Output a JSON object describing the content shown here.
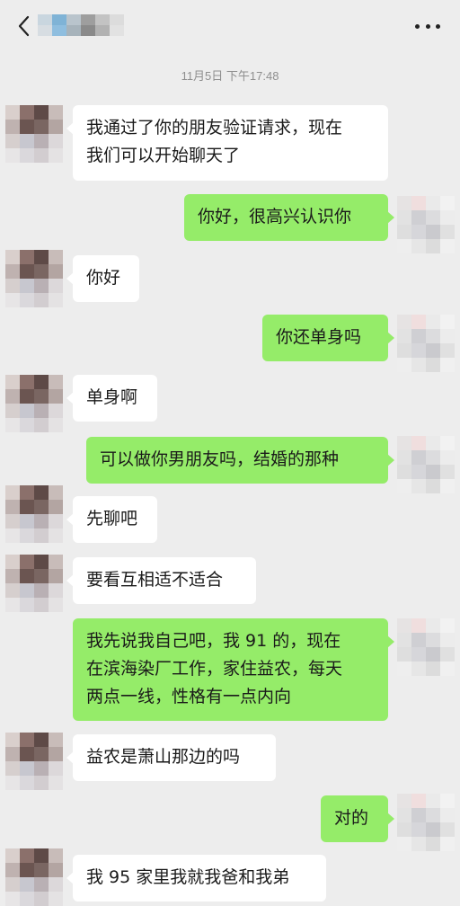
{
  "header": {
    "back_icon": "chevron-left-icon",
    "contact_name_blurred": true,
    "more_icon": "more-dots-icon"
  },
  "chat": {
    "timestamp": "11月5日 下午17:48",
    "messages": [
      {
        "side": "left",
        "text": "我通过了你的朋友验证请求，现在\n我们可以开始聊天了"
      },
      {
        "side": "right",
        "text": "你好，很高兴认识你"
      },
      {
        "side": "left",
        "text": "你好"
      },
      {
        "side": "right",
        "text": "你还单身吗"
      },
      {
        "side": "left",
        "text": "单身啊"
      },
      {
        "side": "right",
        "text": "可以做你男朋友吗，结婚的那种"
      },
      {
        "side": "left",
        "text": "先聊吧"
      },
      {
        "side": "left",
        "text": "要看互相适不适合"
      },
      {
        "side": "right",
        "text": "我先说我自己吧，我 91 的，现在\n在滨海染厂工作，家住益农，每天\n两点一线，性格有一点内向"
      },
      {
        "side": "left",
        "text": "益农是萧山那边的吗"
      },
      {
        "side": "right",
        "text": "对的"
      },
      {
        "side": "left",
        "text": "我 95 家里我就我爸和我弟"
      }
    ]
  },
  "colors": {
    "background": "#ededed",
    "incoming_bubble": "#ffffff",
    "outgoing_bubble": "#95ec69",
    "timestamp_text": "#8f8f8f"
  }
}
